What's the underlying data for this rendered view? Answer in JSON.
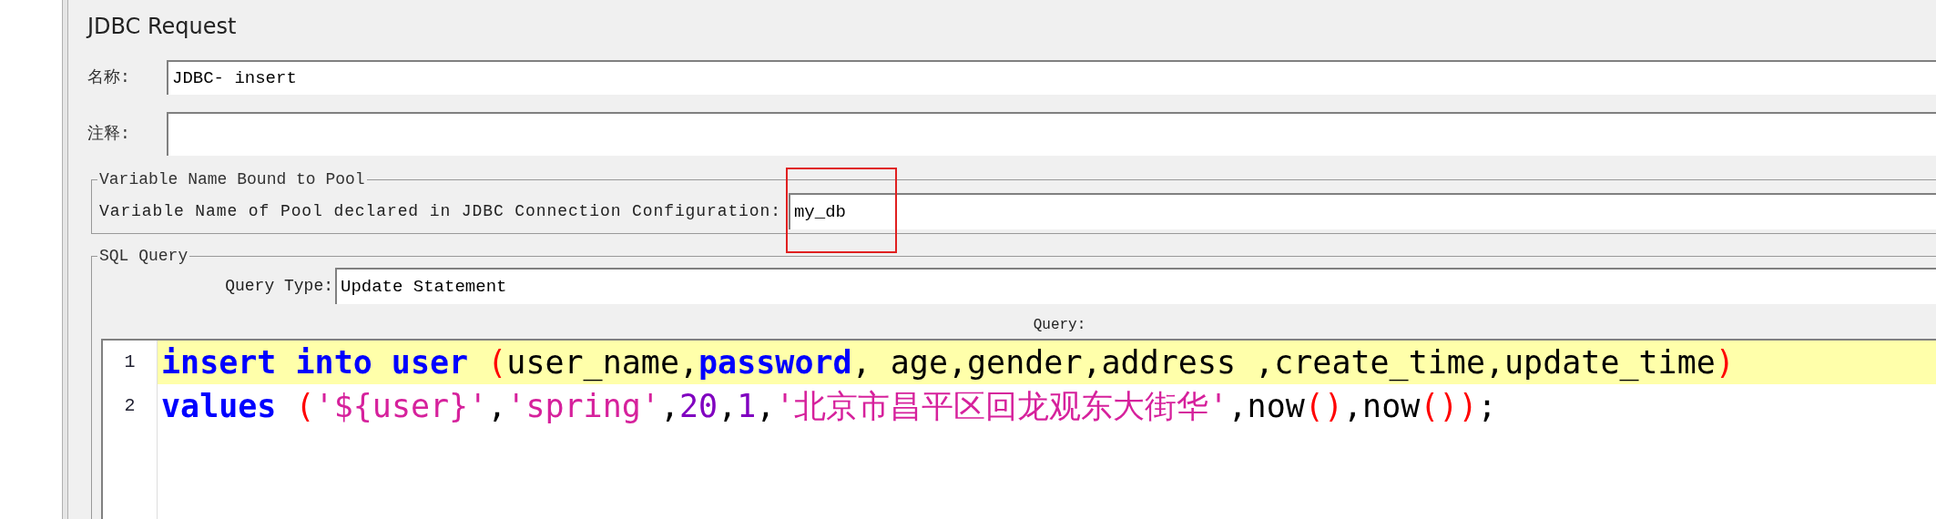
{
  "panel_title": "JDBC Request",
  "name_field": {
    "label": "名称:",
    "value": "JDBC- insert"
  },
  "comment_field": {
    "label": "注释:"
  },
  "pool_group": {
    "title": "Variable Name Bound to Pool",
    "label": "Variable Name of Pool declared in JDBC Connection Configuration:",
    "value": "my_db",
    "highlighted": true
  },
  "sql_group": {
    "title": "SQL Query",
    "query_type_label": "Query Type:",
    "query_type_value": "Update Statement",
    "query_label": "Query:"
  },
  "editor": {
    "lines": [
      {
        "number": "1",
        "current": true,
        "tokens": [
          {
            "text": "insert into user ",
            "kind": "keyword"
          },
          {
            "text": "(",
            "kind": "paren"
          },
          {
            "text": "user_name,",
            "kind": "plain"
          },
          {
            "text": "password",
            "kind": "keyword"
          },
          {
            "text": ", age,gender,address ,create_time,update_time",
            "kind": "plain"
          },
          {
            "text": ")",
            "kind": "paren"
          }
        ]
      },
      {
        "number": "2",
        "current": false,
        "tokens": [
          {
            "text": "values ",
            "kind": "keyword"
          },
          {
            "text": "(",
            "kind": "paren"
          },
          {
            "text": "'${user}'",
            "kind": "string"
          },
          {
            "text": ",",
            "kind": "plain"
          },
          {
            "text": "'spring'",
            "kind": "string"
          },
          {
            "text": ",",
            "kind": "plain"
          },
          {
            "text": "20",
            "kind": "number"
          },
          {
            "text": ",",
            "kind": "plain"
          },
          {
            "text": "1",
            "kind": "number"
          },
          {
            "text": ",",
            "kind": "plain"
          },
          {
            "text": "'北京市昌平区回龙观东大街华'",
            "kind": "string"
          },
          {
            "text": ",now",
            "kind": "plain"
          },
          {
            "text": "()",
            "kind": "paren"
          },
          {
            "text": ",now",
            "kind": "plain"
          },
          {
            "text": "())",
            "kind": "paren"
          },
          {
            "text": ";",
            "kind": "plain"
          }
        ]
      }
    ]
  }
}
